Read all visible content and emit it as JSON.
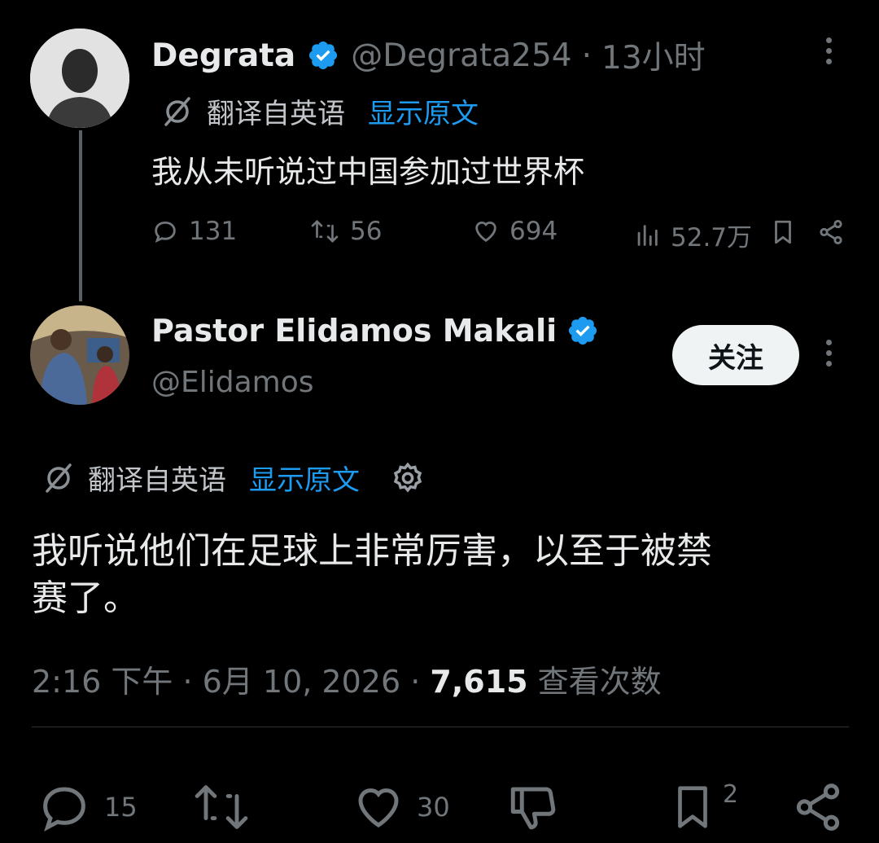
{
  "reply_to": {
    "display_name": "Degrata",
    "handle": "@Degrata254",
    "separator": "·",
    "time_ago": "13小时",
    "translated_label": "翻译自英语",
    "show_original": "显示原文",
    "text": "我从未听说过中国参加过世界杯",
    "stats": {
      "replies": "131",
      "reposts": "56",
      "likes": "694",
      "views": "52.7万"
    }
  },
  "main_post": {
    "display_name": "Pastor Elidamos Makali",
    "handle": "@Elidamos",
    "follow_label": "关注",
    "translated_label": "翻译自英语",
    "show_original": "显示原文",
    "text_line1": "我听说他们在足球上非常厉害，以至于被禁",
    "text_line2": "赛了。",
    "timestamp": "2:16 下午 · 6月 10, 2026 · ",
    "views_count": "7,615",
    "views_label": " 查看次数",
    "actions": {
      "replies": "15",
      "likes": "30",
      "bookmarks": "2"
    }
  },
  "colors": {
    "background": "#000000",
    "text": "#e7e9ea",
    "muted": "#71767b",
    "link": "#1d9bf0",
    "verified": "#1d9bf0"
  }
}
